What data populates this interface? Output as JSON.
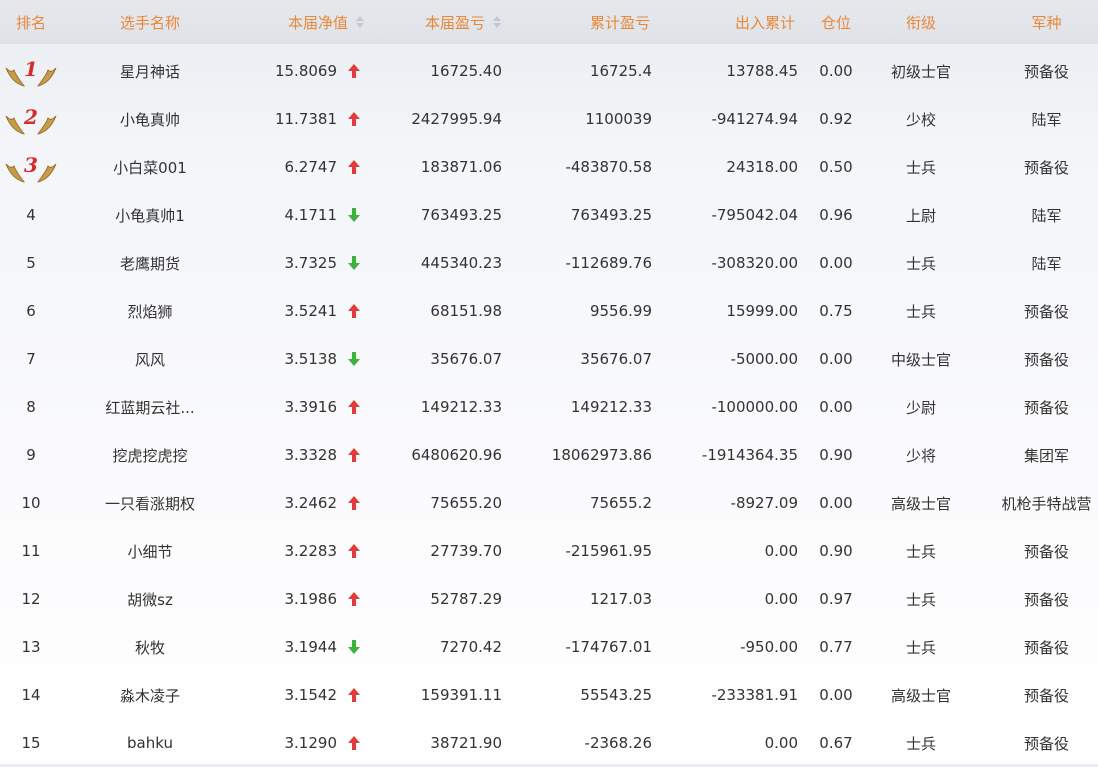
{
  "headers": {
    "rank": "排名",
    "name": "选手名称",
    "nav": "本届净值",
    "pnl": "本届盈亏",
    "cum_pnl": "累计盈亏",
    "io": "出入累计",
    "position": "仓位",
    "title": "衔级",
    "branch": "军种"
  },
  "colors": {
    "header_text": "#e8883a",
    "up_arrow": "#e03c3c",
    "down_arrow": "#3cb43c",
    "medal_number": "#d62b2b"
  },
  "rows": [
    {
      "rank": "1",
      "name": "星月神话",
      "nav": "15.8069",
      "trend": "up",
      "pnl": "16725.40",
      "cum_pnl": "16725.4",
      "io": "13788.45",
      "position": "0.00",
      "title": "初级士官",
      "branch": "预备役"
    },
    {
      "rank": "2",
      "name": "小龟真帅",
      "nav": "11.7381",
      "trend": "up",
      "pnl": "2427995.94",
      "cum_pnl": "1100039",
      "io": "-941274.94",
      "position": "0.92",
      "title": "少校",
      "branch": "陆军"
    },
    {
      "rank": "3",
      "name": "小白菜001",
      "nav": "6.2747",
      "trend": "up",
      "pnl": "183871.06",
      "cum_pnl": "-483870.58",
      "io": "24318.00",
      "position": "0.50",
      "title": "士兵",
      "branch": "预备役"
    },
    {
      "rank": "4",
      "name": "小龟真帅1",
      "nav": "4.1711",
      "trend": "down",
      "pnl": "763493.25",
      "cum_pnl": "763493.25",
      "io": "-795042.04",
      "position": "0.96",
      "title": "上尉",
      "branch": "陆军"
    },
    {
      "rank": "5",
      "name": "老鹰期货",
      "nav": "3.7325",
      "trend": "down",
      "pnl": "445340.23",
      "cum_pnl": "-112689.76",
      "io": "-308320.00",
      "position": "0.00",
      "title": "士兵",
      "branch": "陆军"
    },
    {
      "rank": "6",
      "name": "烈焰狮",
      "nav": "3.5241",
      "trend": "up",
      "pnl": "68151.98",
      "cum_pnl": "9556.99",
      "io": "15999.00",
      "position": "0.75",
      "title": "士兵",
      "branch": "预备役"
    },
    {
      "rank": "7",
      "name": "风风",
      "nav": "3.5138",
      "trend": "down",
      "pnl": "35676.07",
      "cum_pnl": "35676.07",
      "io": "-5000.00",
      "position": "0.00",
      "title": "中级士官",
      "branch": "预备役"
    },
    {
      "rank": "8",
      "name": "红蓝期云社...",
      "nav": "3.3916",
      "trend": "up",
      "pnl": "149212.33",
      "cum_pnl": "149212.33",
      "io": "-100000.00",
      "position": "0.00",
      "title": "少尉",
      "branch": "预备役"
    },
    {
      "rank": "9",
      "name": "挖虎挖虎挖",
      "nav": "3.3328",
      "trend": "up",
      "pnl": "6480620.96",
      "cum_pnl": "18062973.86",
      "io": "-1914364.35",
      "position": "0.90",
      "title": "少将",
      "branch": "集团军"
    },
    {
      "rank": "10",
      "name": "一只看涨期权",
      "nav": "3.2462",
      "trend": "up",
      "pnl": "75655.20",
      "cum_pnl": "75655.2",
      "io": "-8927.09",
      "position": "0.00",
      "title": "高级士官",
      "branch": "机枪手特战营"
    },
    {
      "rank": "11",
      "name": "小细节",
      "nav": "3.2283",
      "trend": "up",
      "pnl": "27739.70",
      "cum_pnl": "-215961.95",
      "io": "0.00",
      "position": "0.90",
      "title": "士兵",
      "branch": "预备役"
    },
    {
      "rank": "12",
      "name": "胡微sz",
      "nav": "3.1986",
      "trend": "up",
      "pnl": "52787.29",
      "cum_pnl": "1217.03",
      "io": "0.00",
      "position": "0.97",
      "title": "士兵",
      "branch": "预备役"
    },
    {
      "rank": "13",
      "name": "秋牧",
      "nav": "3.1944",
      "trend": "down",
      "pnl": "7270.42",
      "cum_pnl": "-174767.01",
      "io": "-950.00",
      "position": "0.77",
      "title": "士兵",
      "branch": "预备役"
    },
    {
      "rank": "14",
      "name": "淼木凌子",
      "nav": "3.1542",
      "trend": "up",
      "pnl": "159391.11",
      "cum_pnl": "55543.25",
      "io": "-233381.91",
      "position": "0.00",
      "title": "高级士官",
      "branch": "预备役"
    },
    {
      "rank": "15",
      "name": "bahku",
      "nav": "3.1290",
      "trend": "up",
      "pnl": "38721.90",
      "cum_pnl": "-2368.26",
      "io": "0.00",
      "position": "0.67",
      "title": "士兵",
      "branch": "预备役"
    }
  ]
}
